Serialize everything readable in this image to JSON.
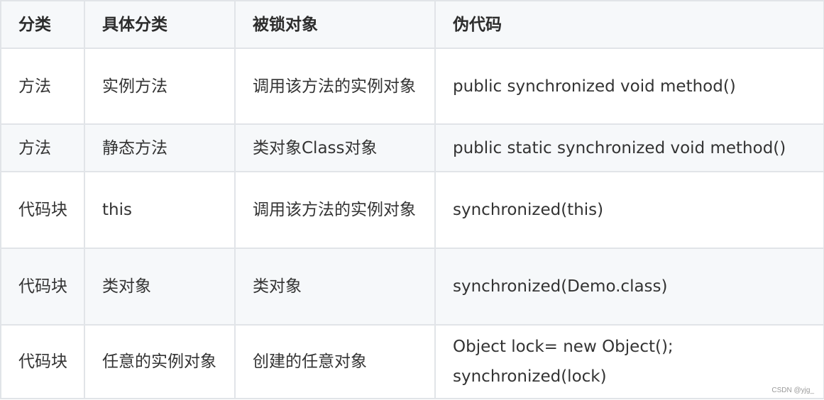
{
  "table": {
    "headers": [
      "分类",
      "具体分类",
      "被锁对象",
      "伪代码"
    ],
    "rows": [
      {
        "category": "方法",
        "subcategory": "实例方法",
        "locked_object": "调用该方法的实例对象",
        "pseudocode": [
          "public synchronized void method()"
        ]
      },
      {
        "category": "方法",
        "subcategory": "静态方法",
        "locked_object": "类对象Class对象",
        "pseudocode": [
          "public static synchronized void method()"
        ]
      },
      {
        "category": "代码块",
        "subcategory": "this",
        "locked_object": "调用该方法的实例对象",
        "pseudocode": [
          "synchronized(this)"
        ]
      },
      {
        "category": "代码块",
        "subcategory": "类对象",
        "locked_object": "类对象",
        "pseudocode": [
          "synchronized(Demo.class)"
        ]
      },
      {
        "category": "代码块",
        "subcategory": "任意的实例对象",
        "locked_object": "创建的任意对象",
        "pseudocode": [
          "Object lock= new Object();",
          "synchronized(lock)"
        ]
      }
    ]
  },
  "watermark": "CSDN @yjg_",
  "colors": {
    "border": "#e1e4e8",
    "header_bg": "#f6f8fa",
    "alt_row_bg": "#f6f8fa",
    "text": "#333333"
  }
}
